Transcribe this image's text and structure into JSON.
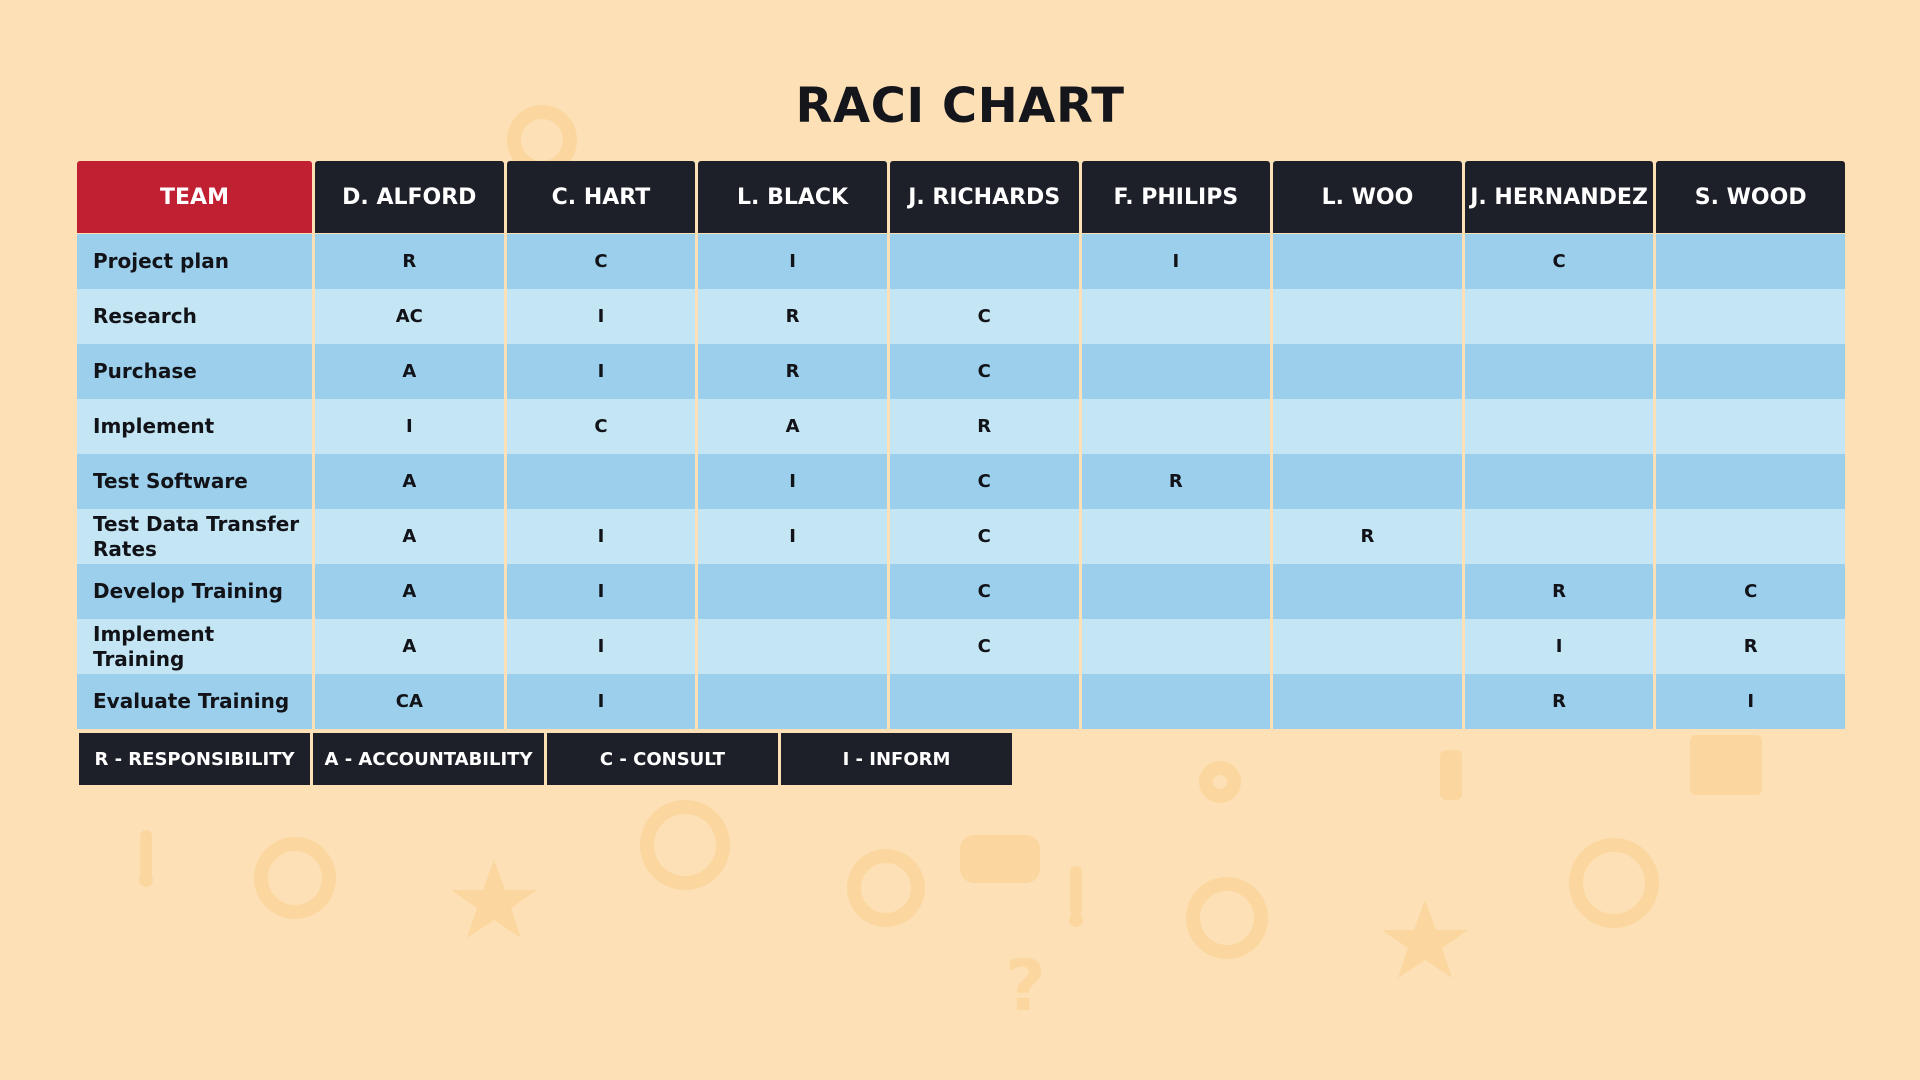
{
  "title": "RACI CHART",
  "chart_data": {
    "type": "table",
    "title": "RACI CHART",
    "columns": [
      "TEAM",
      "D. ALFORD",
      "C. HART",
      "L. BLACK",
      "J. RICHARDS",
      "F. PHILIPS",
      "L. WOO",
      "J. HERNANDEZ",
      "S. WOOD"
    ],
    "rows": [
      {
        "task": "Project plan",
        "cells": [
          "R",
          "C",
          "I",
          "",
          "I",
          "",
          "C",
          ""
        ]
      },
      {
        "task": "Research",
        "cells": [
          "AC",
          "I",
          "R",
          "C",
          "",
          "",
          "",
          ""
        ]
      },
      {
        "task": "Purchase",
        "cells": [
          "A",
          "I",
          "R",
          "C",
          "",
          "",
          "",
          ""
        ]
      },
      {
        "task": "Implement",
        "cells": [
          "I",
          "C",
          "A",
          "R",
          "",
          "",
          "",
          ""
        ]
      },
      {
        "task": "Test  Software",
        "cells": [
          "A",
          "",
          "I",
          "C",
          "R",
          "",
          "",
          ""
        ]
      },
      {
        "task": "Test Data Transfer Rates",
        "cells": [
          "A",
          "I",
          "I",
          "C",
          "",
          "R",
          "",
          ""
        ]
      },
      {
        "task": "Develop Training",
        "cells": [
          "A",
          "I",
          "",
          "C",
          "",
          "",
          "R",
          "C"
        ]
      },
      {
        "task": "Implement Training",
        "cells": [
          "A",
          "I",
          "",
          "C",
          "",
          "",
          "I",
          "R"
        ]
      },
      {
        "task": "Evaluate Training",
        "cells": [
          "CA",
          "I",
          "",
          "",
          "",
          "",
          "R",
          "I"
        ]
      }
    ],
    "legend": [
      "R - RESPONSIBILITY",
      "A - ACCOUNTABILITY",
      "C - CONSULT",
      "I - INFORM"
    ]
  },
  "colors": {
    "background": "#fde0b5",
    "team_header": "#c11f32",
    "person_header": "#1e2029",
    "row_dark": "#9ccfec",
    "row_light": "#c4e5f4"
  },
  "background_icons": [
    "gear-icon",
    "star-icon",
    "exclamation-icon",
    "chat-bubble-icon",
    "question-icon",
    "lightbulb-icon",
    "trophy-icon",
    "calendar-icon"
  ]
}
